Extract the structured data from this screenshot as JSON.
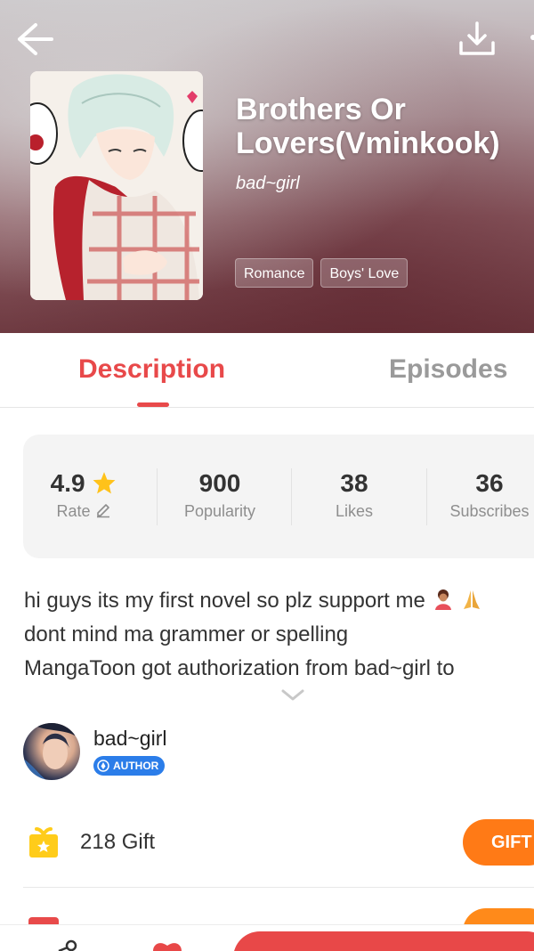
{
  "header": {
    "back_icon": "arrow-left-icon",
    "download_icon": "download-icon",
    "more_icon": "more-vertical-icon"
  },
  "book": {
    "title": "Brothers Or Lovers(Vminkook)",
    "author": "bad~girl",
    "tags": [
      "Romance",
      "Boys' Love"
    ]
  },
  "tabs": [
    {
      "label": "Description",
      "active": true
    },
    {
      "label": "Episodes",
      "active": false
    }
  ],
  "stats": {
    "rating": {
      "value": "4.9",
      "label": "Rate"
    },
    "popularity": {
      "value": "900",
      "label": "Popularity"
    },
    "likes": {
      "value": "38",
      "label": "Likes"
    },
    "subscribes": {
      "value": "36",
      "label": "Subscribes"
    }
  },
  "description": {
    "lines": [
      "hi guys its my first novel so plz support me",
      "dont mind ma grammer or spelling",
      "MangaToon got authorization from bad~girl to"
    ]
  },
  "author": {
    "name": "bad~girl",
    "badge": "AUTHOR"
  },
  "gift": {
    "count_text": "218 Gift",
    "button_label": "GIFT"
  },
  "colors": {
    "accent": "#e8494a",
    "gift_orange": "#ff7a16",
    "author_badge": "#2b7de9",
    "star": "#ffc21a"
  }
}
